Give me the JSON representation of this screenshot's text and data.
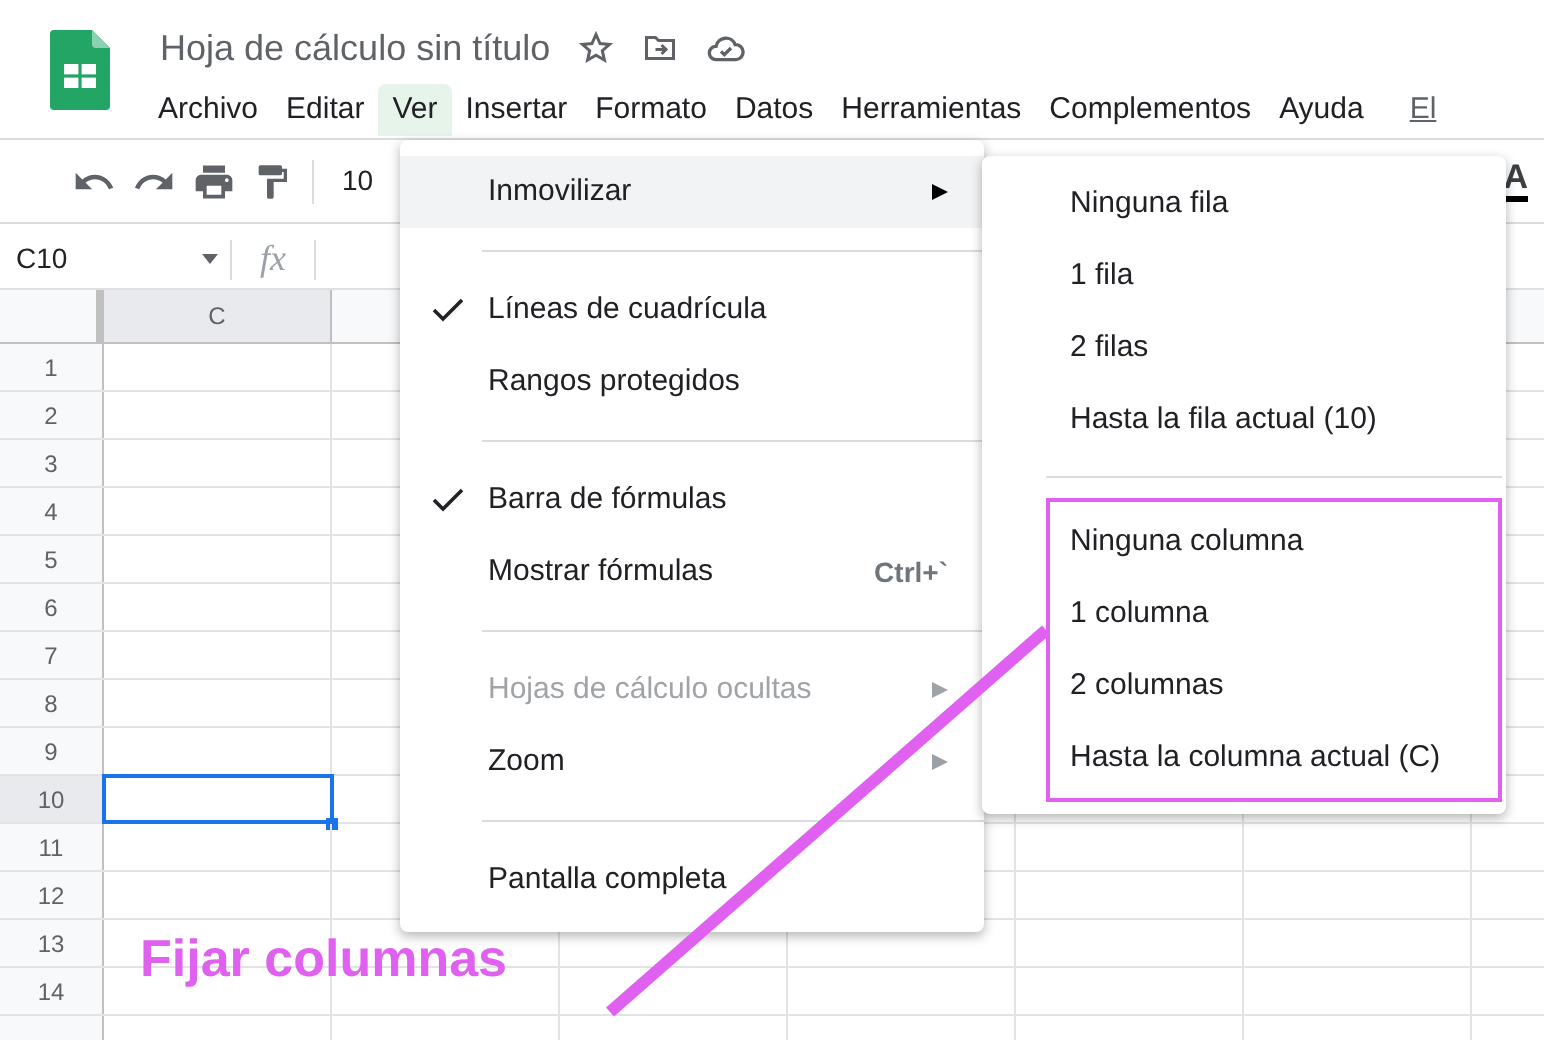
{
  "document_title": "Hoja de cálculo sin título",
  "menubar": [
    {
      "label": "Archivo",
      "selected": false
    },
    {
      "label": "Editar",
      "selected": false
    },
    {
      "label": "Ver",
      "selected": true
    },
    {
      "label": "Insertar",
      "selected": false
    },
    {
      "label": "Formato",
      "selected": false
    },
    {
      "label": "Datos",
      "selected": false
    },
    {
      "label": "Herramientas",
      "selected": false
    },
    {
      "label": "Complementos",
      "selected": false
    },
    {
      "label": "Ayuda",
      "selected": false
    }
  ],
  "last_edit_link": "El",
  "toolbar": {
    "zoom": "10",
    "text_color": "A"
  },
  "name_box": "C10",
  "function_label": "fx",
  "sheet": {
    "column_header": "C",
    "rows": [
      {
        "label": "1",
        "selected": false
      },
      {
        "label": "2",
        "selected": false
      },
      {
        "label": "3",
        "selected": false
      },
      {
        "label": "4",
        "selected": false
      },
      {
        "label": "5",
        "selected": false
      },
      {
        "label": "6",
        "selected": false
      },
      {
        "label": "7",
        "selected": false
      },
      {
        "label": "8",
        "selected": false
      },
      {
        "label": "9",
        "selected": false
      },
      {
        "label": "10",
        "selected": true
      },
      {
        "label": "11",
        "selected": false
      },
      {
        "label": "12",
        "selected": false
      },
      {
        "label": "13",
        "selected": false
      },
      {
        "label": "14",
        "selected": false
      }
    ]
  },
  "view_menu": [
    {
      "kind": "item",
      "label": "Inmovilizar",
      "checked": false,
      "disabled": false,
      "submenu": true,
      "selected": true
    },
    {
      "kind": "separator"
    },
    {
      "kind": "item",
      "label": "Líneas de cuadrícula",
      "checked": true,
      "disabled": false,
      "submenu": false,
      "selected": false
    },
    {
      "kind": "item",
      "label": "Rangos protegidos",
      "checked": false,
      "disabled": false,
      "submenu": false,
      "selected": false
    },
    {
      "kind": "separator"
    },
    {
      "kind": "item",
      "label": "Barra de fórmulas",
      "checked": true,
      "disabled": false,
      "submenu": false,
      "selected": false
    },
    {
      "kind": "item",
      "label": "Mostrar fórmulas",
      "shortcut": "Ctrl+`",
      "checked": false,
      "disabled": false,
      "submenu": false,
      "selected": false
    },
    {
      "kind": "separator"
    },
    {
      "kind": "item",
      "label": "Hojas de cálculo ocultas",
      "checked": false,
      "disabled": true,
      "submenu": true,
      "selected": false
    },
    {
      "kind": "item",
      "label": "Zoom",
      "checked": false,
      "disabled": false,
      "submenu": true,
      "selected": false
    },
    {
      "kind": "separator"
    },
    {
      "kind": "item",
      "label": "Pantalla completa",
      "checked": false,
      "disabled": false,
      "submenu": false,
      "selected": false
    }
  ],
  "freeze_submenu": {
    "rows": [
      "Ninguna fila",
      "1 fila",
      "2 filas",
      "Hasta la fila actual (10)"
    ],
    "columns": [
      "Ninguna columna",
      "1 columna",
      "2 columnas",
      "Hasta la columna actual (C)"
    ]
  },
  "annotation": {
    "label": "Fijar columnas"
  }
}
